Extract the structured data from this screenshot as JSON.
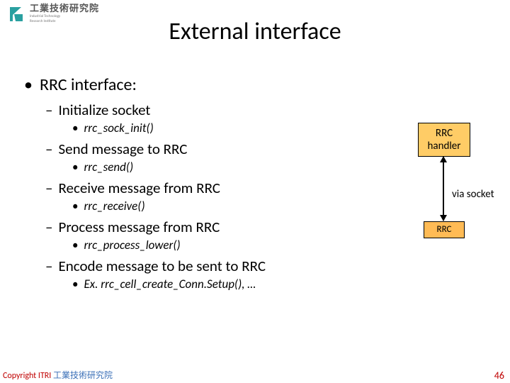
{
  "logo": {
    "cjk": "工業技術研究院",
    "en_line1": "Industrial Technology",
    "en_line2": "Research Institute"
  },
  "title": "External interface",
  "list": {
    "h1": "RRC interface:",
    "items": [
      {
        "h2": "Initialize socket",
        "h3": "rrc_sock_init()"
      },
      {
        "h2": "Send message to RRC",
        "h3": "rrc_send()"
      },
      {
        "h2": "Receive message from RRC",
        "h3": "rrc_receive()"
      },
      {
        "h2": "Process message from RRC",
        "h3": "rrc_process_lower()"
      },
      {
        "h2": "Encode message to be sent to RRC",
        "h3": "Ex. rrc_cell_create_Conn.Setup(), …"
      }
    ]
  },
  "diagram": {
    "top": "RRC handler",
    "bottom": "RRC",
    "edge": "via socket"
  },
  "footer": {
    "copyright_red": "Copyright  ITRI",
    "copyright_blue": " 工業技術研究院",
    "page": "46"
  }
}
